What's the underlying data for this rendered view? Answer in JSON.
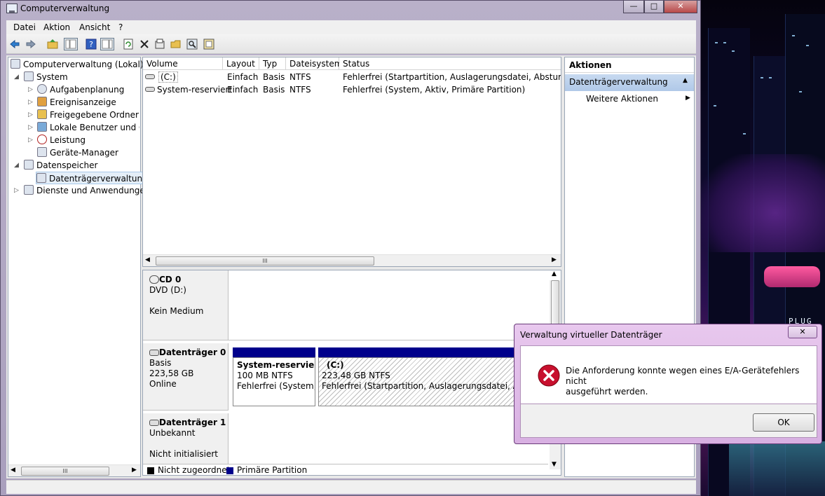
{
  "window": {
    "title": "Computerverwaltung",
    "min_glyph": "—",
    "max_glyph": "□",
    "close_glyph": "✕"
  },
  "menubar": [
    "Datei",
    "Aktion",
    "Ansicht",
    "?"
  ],
  "toolbar_icons": [
    "back-arrow-icon",
    "forward-arrow-icon",
    "up-folder-icon",
    "show-hide-tree-icon",
    "help-icon",
    "show-hide-action-icon",
    "refresh-icon",
    "delete-icon",
    "properties-icon",
    "open-icon",
    "search-icon",
    "properties-alt-icon"
  ],
  "tree": {
    "root": "Computerverwaltung (Lokal)",
    "system": "System",
    "aufgaben": "Aufgabenplanung",
    "ereignis": "Ereignisanzeige",
    "freigabe": "Freigegebene Ordner",
    "lokale": "Lokale Benutzer und Gr",
    "leistung": "Leistung",
    "geraete": "Geräte-Manager",
    "datenspeicher": "Datenspeicher",
    "datentraeger": "Datenträgerverwaltung",
    "dienste": "Dienste und Anwendungen"
  },
  "volume_list": {
    "columns": [
      "Volume",
      "Layout",
      "Typ",
      "Dateisystem",
      "Status"
    ],
    "rows": [
      [
        "(C:)",
        "Einfach",
        "Basis",
        "NTFS",
        "Fehlerfrei (Startpartition, Auslagerungsdatei, Absturzabbild"
      ],
      [
        "System-reserviert",
        "Einfach",
        "Basis",
        "NTFS",
        "Fehlerfrei (System, Aktiv, Primäre Partition)"
      ]
    ]
  },
  "scroll_thumb": "III",
  "disks": {
    "cd0": {
      "name": "CD 0",
      "line1": "DVD (D:)",
      "line2": "",
      "line3": "Kein Medium"
    },
    "disk0": {
      "name": "Datenträger 0",
      "line1": "Basis",
      "line2": "223,58 GB",
      "line3": "Online"
    },
    "disk1": {
      "name": "Datenträger 1",
      "line1": "Unbekannt",
      "line2": "",
      "line3": "Nicht initialisiert"
    }
  },
  "partitions": {
    "p1": {
      "name": "System-reserviert",
      "size": "100 MB NTFS",
      "status": "Fehlerfrei (System, A"
    },
    "p2": {
      "name": "(C:)",
      "size": "223,48 GB NTFS",
      "status": "Fehlerfrei (Startpartition, Auslagerungsdatei, Absturz"
    }
  },
  "legend": {
    "unallocated": "Nicht zugeordnet",
    "primary": "Primäre Partition",
    "unallocated_color": "#000000",
    "primary_color": "#00008b"
  },
  "actions": {
    "header": "Aktionen",
    "section": "Datenträgerverwaltung",
    "more": "Weitere Aktionen"
  },
  "dialog": {
    "title": "Verwaltung virtueller Datenträger",
    "close_glyph": "✕",
    "message_line1": "Die Anforderung konnte wegen eines E/A-Gerätefehlers nicht",
    "message_line2": "ausgeführt werden.",
    "ok": "OK",
    "error_color": "#c8102e"
  },
  "desktop_sign": "PLUG"
}
